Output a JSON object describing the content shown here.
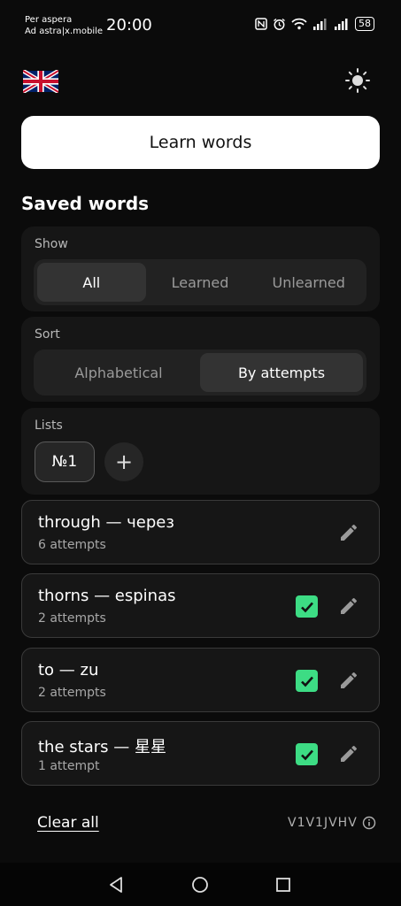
{
  "status": {
    "carrier_line1": "Per aspera",
    "carrier_line2": "Ad astra|x.mobile",
    "time": "20:00",
    "battery": "58"
  },
  "header": {
    "language_flag": "uk-flag-icon",
    "theme_toggle": "sun-icon",
    "learn_button": "Learn words"
  },
  "saved": {
    "title": "Saved words",
    "show": {
      "label": "Show",
      "options": [
        "All",
        "Learned",
        "Unlearned"
      ],
      "selected": "All"
    },
    "sort": {
      "label": "Sort",
      "options": [
        "Alphabetical",
        "By attempts"
      ],
      "selected": "By attempts"
    },
    "lists": {
      "label": "Lists",
      "items": [
        "№1"
      ],
      "add": "+"
    }
  },
  "words": [
    {
      "title": "through — через",
      "attempts": "6 attempts",
      "learned": false
    },
    {
      "title": "thorns — espinas",
      "attempts": "2 attempts",
      "learned": true
    },
    {
      "title": "to — zu",
      "attempts": "2 attempts",
      "learned": true
    },
    {
      "title": "the stars — 星星",
      "attempts": "1 attempt",
      "learned": true
    }
  ],
  "footer": {
    "clear_all": "Clear all",
    "version": "V1V1JVHV"
  },
  "colors": {
    "background": "#0b0b0b",
    "panel": "#161616",
    "accent_check": "#3ddc84",
    "button_bg": "#ffffff"
  }
}
